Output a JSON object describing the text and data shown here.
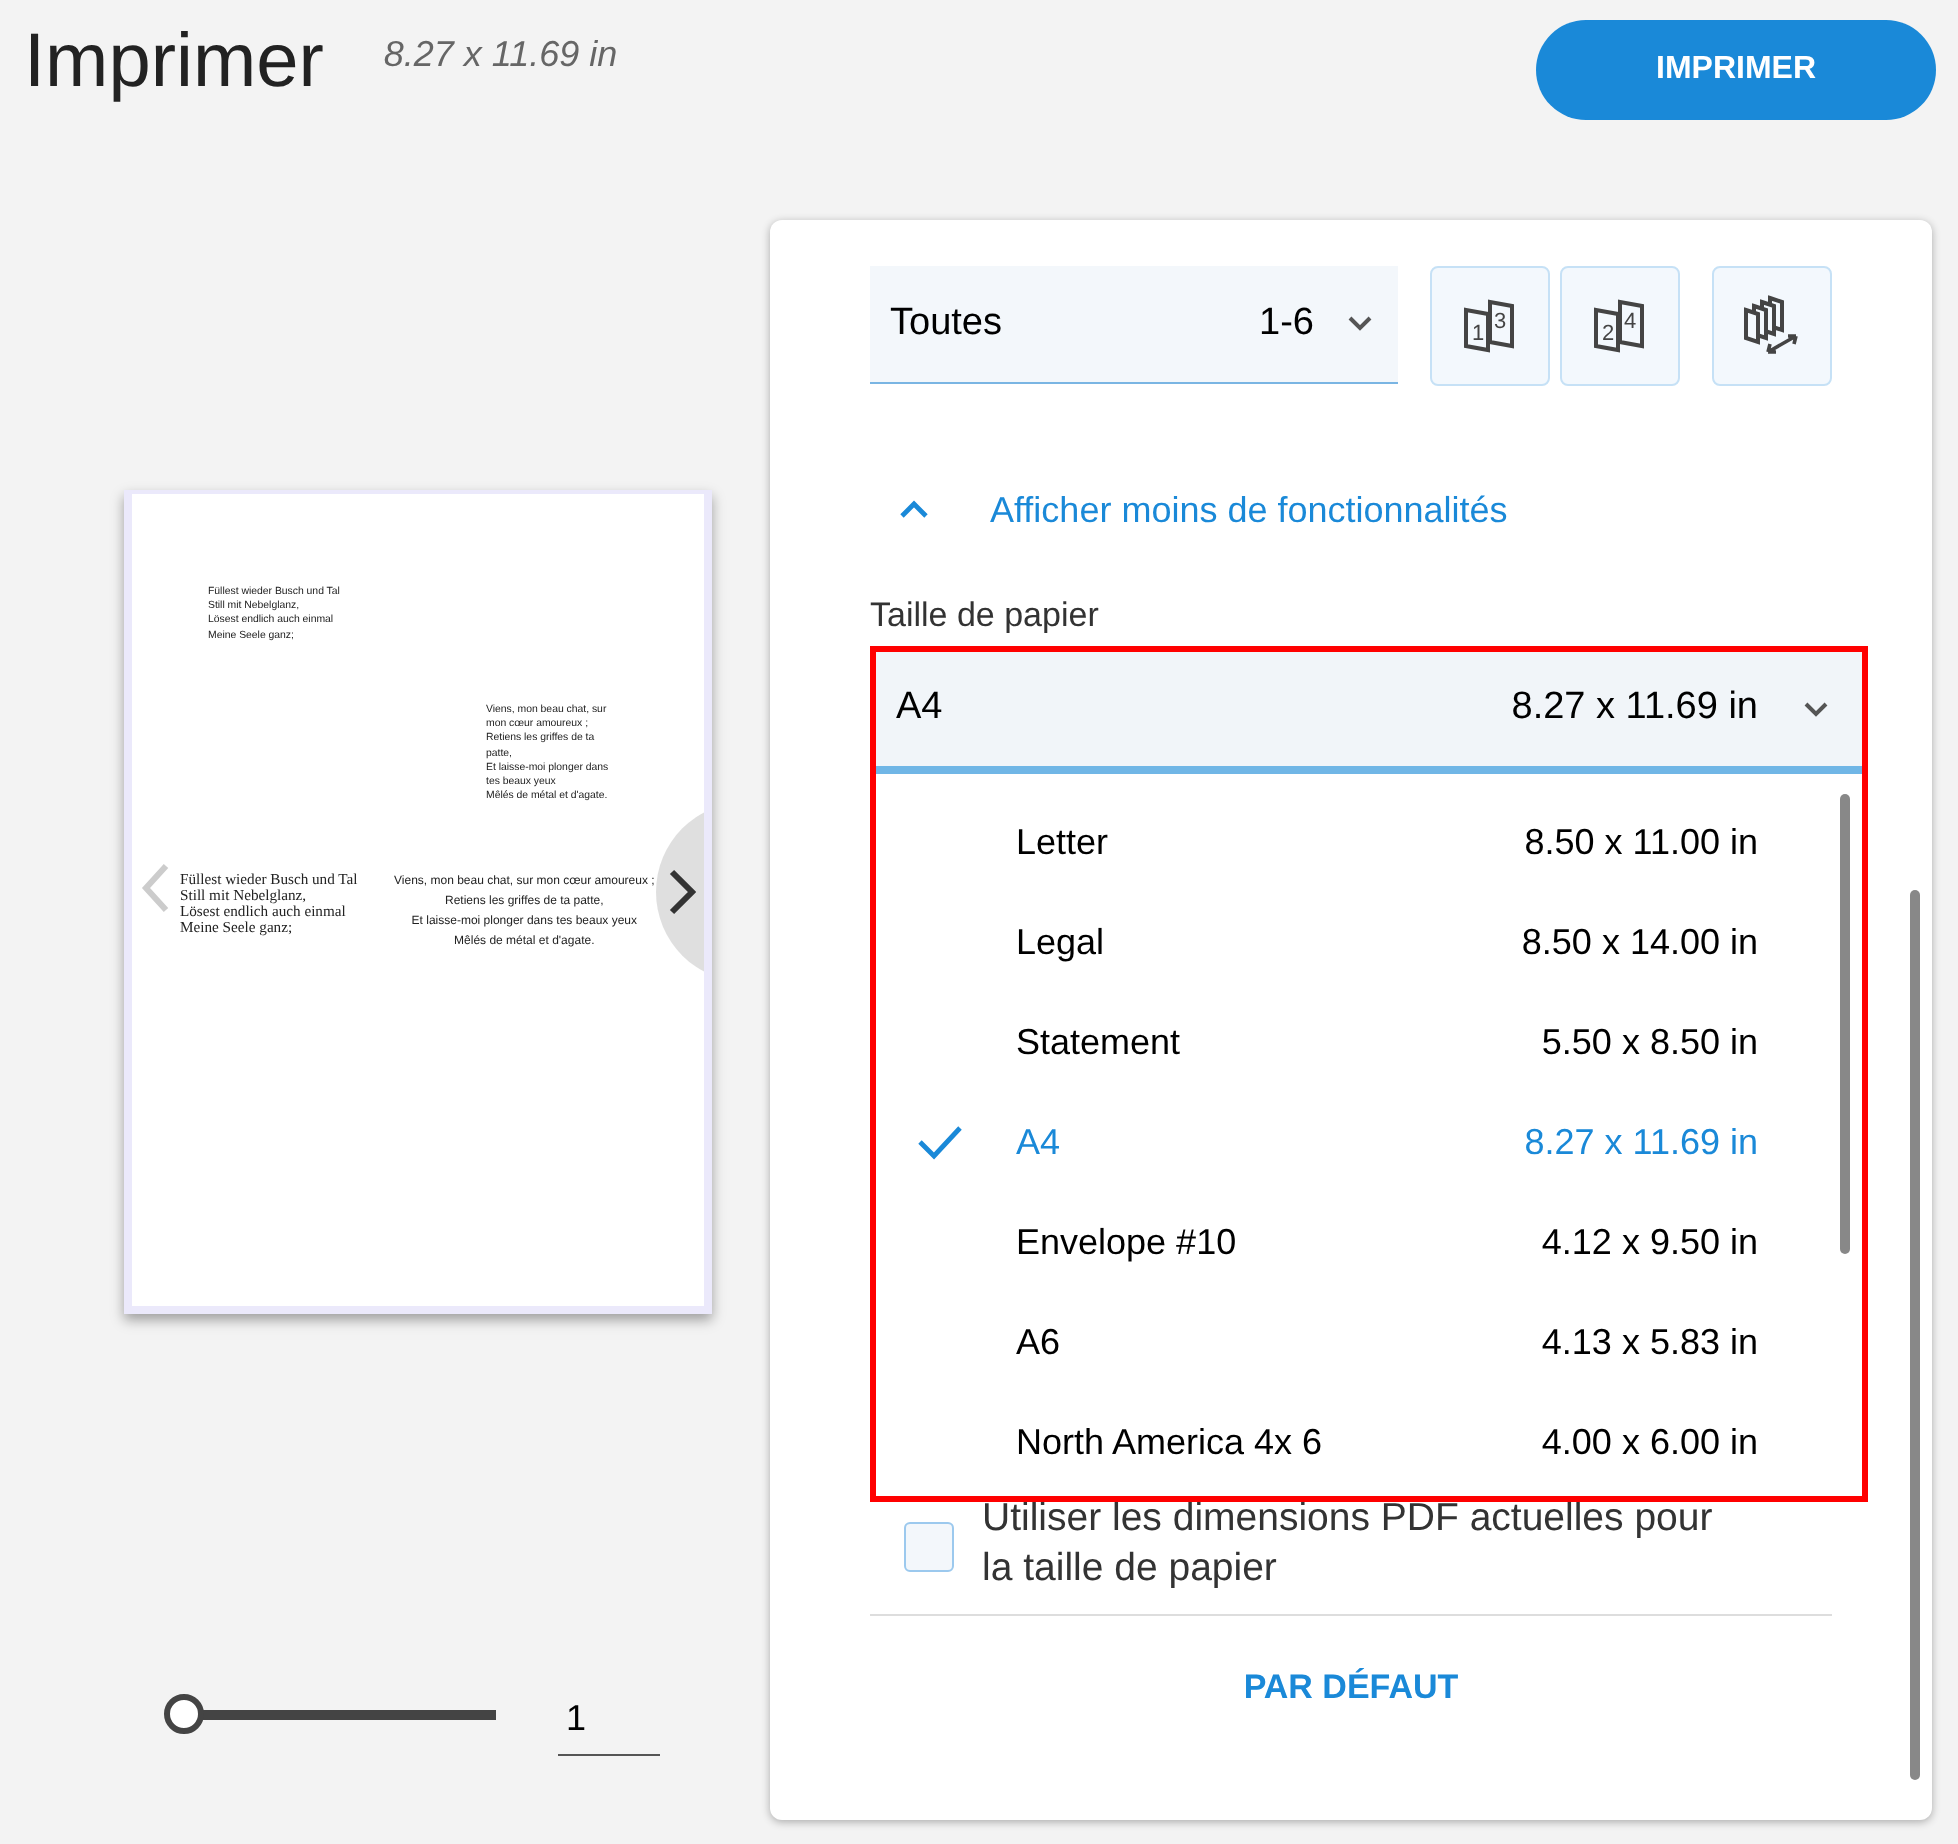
{
  "header": {
    "title": "Imprimer",
    "page_size": "8.27 x 11.69 in",
    "print_button": "IMPRIMER"
  },
  "preview": {
    "blocks": [
      {
        "kind": "sans",
        "lines": [
          "Füllest wieder Busch und Tal",
          "Still mit Nebelglanz,",
          "Lösest endlich auch einmal",
          "Meine Seele ganz;"
        ]
      },
      {
        "kind": "sans",
        "lines": [
          "Viens, mon beau chat, sur",
          "mon cœur amoureux ;",
          "Retiens les griffes de ta",
          "patte,",
          "Et laisse-moi plonger dans",
          "tes beaux yeux",
          "Mêlés de métal et d'agate."
        ]
      },
      {
        "kind": "serif",
        "lines": [
          "Füllest wieder Busch und Tal",
          "Still mit Nebelglanz,",
          "Lösest endlich auch einmal",
          "Meine Seele ganz;"
        ]
      },
      {
        "kind": "sans-large",
        "lines": [
          "Viens, mon beau chat, sur mon cœur amoureux ;",
          "Retiens les griffes de ta patte,",
          "Et laisse-moi plonger dans tes beaux yeux",
          "Mêlés de métal et d'agate."
        ]
      }
    ],
    "zoom": {
      "level": 0
    },
    "page_number": "1"
  },
  "settings": {
    "pages": {
      "value": "Toutes",
      "range": "1-6"
    },
    "layout_buttons": [
      {
        "kind": "odd",
        "labels": [
          "1",
          "3"
        ]
      },
      {
        "kind": "even",
        "labels": [
          "2",
          "4"
        ]
      },
      {
        "kind": "collate"
      }
    ],
    "more_toggle": {
      "label": "Afficher moins de fonctionnalités",
      "expanded": true
    },
    "paper_size": {
      "label": "Taille de papier",
      "value": "A4",
      "dims": "8.27 x 11.69 in",
      "expanded": true,
      "options": [
        {
          "name": "Letter",
          "dims": "8.50 x 11.00 in",
          "selected": false
        },
        {
          "name": "Legal",
          "dims": "8.50 x 14.00 in",
          "selected": false
        },
        {
          "name": "Statement",
          "dims": "5.50 x 8.50 in",
          "selected": false
        },
        {
          "name": "A4",
          "dims": "8.27 x 11.69 in",
          "selected": true
        },
        {
          "name": "Envelope #10",
          "dims": "4.12 x 9.50 in",
          "selected": false
        },
        {
          "name": "A6",
          "dims": "4.13 x 5.83 in",
          "selected": false
        },
        {
          "name": "North America 4x 6",
          "dims": "4.00 x 6.00 in",
          "selected": false
        }
      ]
    },
    "use_pdf_size": {
      "label": "Utiliser les dimensions PDF actuelles pour la taille de papier",
      "checked": false
    },
    "default_button": "PAR DÉFAUT"
  }
}
